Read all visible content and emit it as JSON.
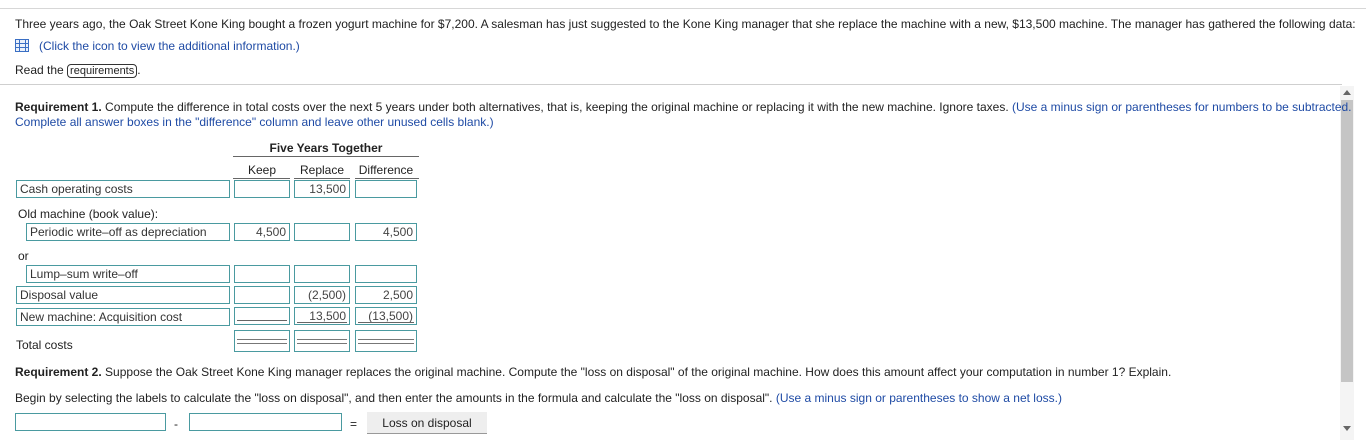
{
  "intro": {
    "text": "Three years ago, the Oak Street Kone King bought a frozen yogurt machine for $7,200. A salesman has just suggested to the Kone King manager that she replace the machine with a new, $13,500 machine. The manager has gathered the following data:",
    "icon_link": "(Click the icon to view the additional information.)",
    "read_the": "Read the",
    "requirements_button": "requirements",
    "period": "."
  },
  "req1": {
    "title": "Requirement 1.",
    "text": " Compute the difference in total costs over the next 5 years under both alternatives, that is, keeping the original machine or replacing it with the new machine. Ignore taxes.",
    "hint": " (Use a minus sign or parentheses for numbers to be subtracted.",
    "hint2": "Complete all answer boxes in the \"difference\" column and leave other unused cells blank.)"
  },
  "table": {
    "group_header": "Five Years Together",
    "col_keep": "Keep",
    "col_replace": "Replace",
    "col_difference": "Difference",
    "rows": {
      "cash_operating": {
        "label": "Cash operating costs",
        "keep": "",
        "replace": "13,500",
        "difference": ""
      },
      "old_machine_header": "Old machine (book value):",
      "periodic": {
        "label": "Periodic write–off as depreciation",
        "keep": "4,500",
        "replace": "",
        "difference": "4,500"
      },
      "or": "or",
      "lump_sum": {
        "label": "Lump–sum write–off",
        "keep": "",
        "replace": "",
        "difference": ""
      },
      "disposal": {
        "label": "Disposal value",
        "keep": "",
        "replace": "(2,500)",
        "difference": "2,500"
      },
      "new_machine": {
        "label": "New machine: Acquisition cost",
        "keep": "",
        "replace": "13,500",
        "difference": "(13,500)"
      },
      "total": {
        "label": "Total costs",
        "keep": "",
        "replace": "",
        "difference": ""
      }
    }
  },
  "req2": {
    "title": "Requirement 2.",
    "text": " Suppose the Oak Street Kone King manager replaces the original machine. Compute the \"loss on disposal\" of the original machine. How does this amount affect your computation in number 1? Explain.",
    "instruction": "Begin by selecting the labels to calculate the \"loss on disposal\", and then enter the amounts in the formula and calculate the \"loss on disposal\".",
    "hint": " (Use a minus sign or parentheses to show a net loss.)",
    "minus": "-",
    "equals": "=",
    "loss_label": "Loss on disposal"
  },
  "colors": {
    "accent": "#1f4ba5",
    "box_border": "#4a9aa0"
  }
}
